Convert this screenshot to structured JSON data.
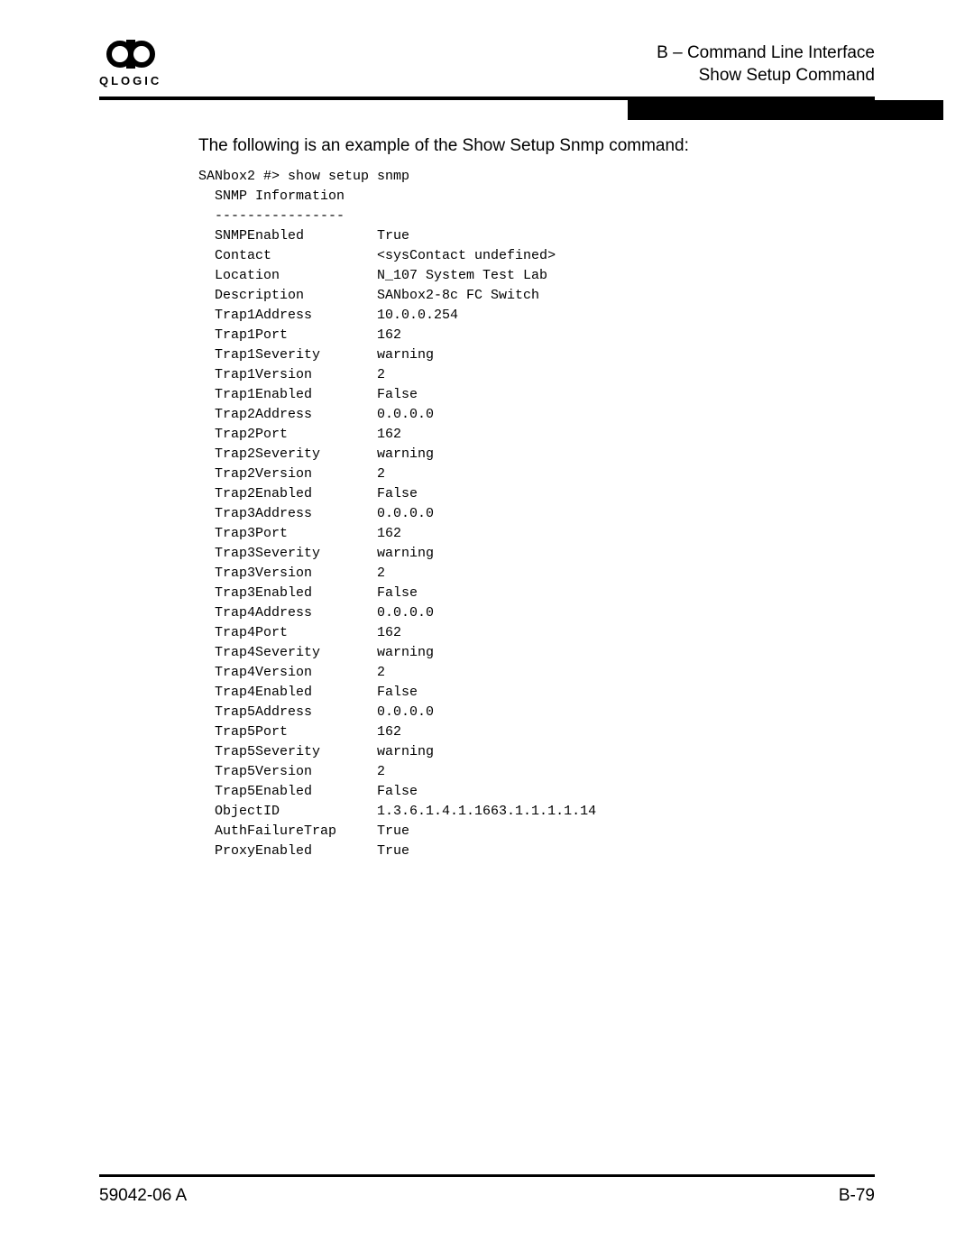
{
  "header": {
    "brand": "QLOGIC",
    "line1": "B – Command Line Interface",
    "line2": "Show Setup Command"
  },
  "intro": "The following is an example of the Show Setup Snmp command:",
  "prompt": "SANbox2 #> show setup snmp",
  "section_title": "SNMP Information",
  "section_rule": "----------------",
  "rows": [
    {
      "k": "SNMPEnabled",
      "v": "True"
    },
    {
      "k": "Contact",
      "v": "<sysContact undefined>"
    },
    {
      "k": "Location",
      "v": "N_107 System Test Lab"
    },
    {
      "k": "Description",
      "v": "SANbox2-8c FC Switch"
    },
    {
      "k": "Trap1Address",
      "v": "10.0.0.254"
    },
    {
      "k": "Trap1Port",
      "v": "162"
    },
    {
      "k": "Trap1Severity",
      "v": "warning"
    },
    {
      "k": "Trap1Version",
      "v": "2"
    },
    {
      "k": "Trap1Enabled",
      "v": "False"
    },
    {
      "k": "Trap2Address",
      "v": "0.0.0.0"
    },
    {
      "k": "Trap2Port",
      "v": "162"
    },
    {
      "k": "Trap2Severity",
      "v": "warning"
    },
    {
      "k": "Trap2Version",
      "v": "2"
    },
    {
      "k": "Trap2Enabled",
      "v": "False"
    },
    {
      "k": "Trap3Address",
      "v": "0.0.0.0"
    },
    {
      "k": "Trap3Port",
      "v": "162"
    },
    {
      "k": "Trap3Severity",
      "v": "warning"
    },
    {
      "k": "Trap3Version",
      "v": "2"
    },
    {
      "k": "Trap3Enabled",
      "v": "False"
    },
    {
      "k": "Trap4Address",
      "v": "0.0.0.0"
    },
    {
      "k": "Trap4Port",
      "v": "162"
    },
    {
      "k": "Trap4Severity",
      "v": "warning"
    },
    {
      "k": "Trap4Version",
      "v": "2"
    },
    {
      "k": "Trap4Enabled",
      "v": "False"
    },
    {
      "k": "Trap5Address",
      "v": "0.0.0.0"
    },
    {
      "k": "Trap5Port",
      "v": "162"
    },
    {
      "k": "Trap5Severity",
      "v": "warning"
    },
    {
      "k": "Trap5Version",
      "v": "2"
    },
    {
      "k": "Trap5Enabled",
      "v": "False"
    },
    {
      "k": "ObjectID",
      "v": "1.3.6.1.4.1.1663.1.1.1.1.14"
    },
    {
      "k": "AuthFailureTrap",
      "v": "True"
    },
    {
      "k": "ProxyEnabled",
      "v": "True"
    }
  ],
  "footer": {
    "left": "59042-06 A",
    "right": "B-79"
  }
}
